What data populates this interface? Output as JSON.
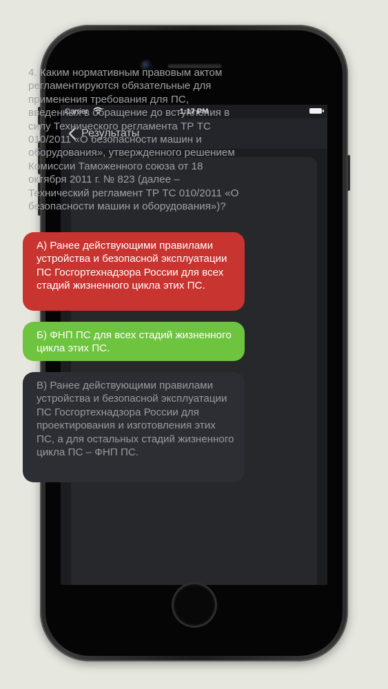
{
  "status_bar": {
    "carrier": "Carrier",
    "time": "1:17 PM"
  },
  "nav": {
    "back_label": "Результаты"
  },
  "question": {
    "text": "4. Каким нормативным правовым актом регламентируются обязательные для применения требования для ПС, введенных в обращение до вступления в силу Технического регламента ТР ТС 010/2011 «О безопасности машин и оборудования», утвержденного решением Комиссии Таможенного союза от 18 октября 2011 г. № 823 (далее – Технический регламент ТР ТС 010/2011 «О безопасности машин и оборудования»)?"
  },
  "answers": [
    {
      "text": "А) Ранее действующими правилами устройства и безопасной эксплуатации ПС Госгортехнадзора России для всех стадий жизненного цикла этих ПС.",
      "state": "incorrect",
      "color": "#c8342f"
    },
    {
      "text": "Б) ФНП ПС для всех стадий жизненного цикла этих ПС.",
      "state": "correct",
      "color": "#6ec43e"
    },
    {
      "text": "В) Ранее действующими правилами устройства и безопасной эксплуатации ПС Госгортехнадзора России для проектирования и изготовления этих ПС, а для остальных стадий жизненного цикла ПС – ФНП ПС.",
      "state": "neutral",
      "color": "#2c2e33"
    }
  ],
  "icons": {
    "back": "chevron-left-icon",
    "wifi": "wifi-icon",
    "battery": "battery-icon"
  }
}
